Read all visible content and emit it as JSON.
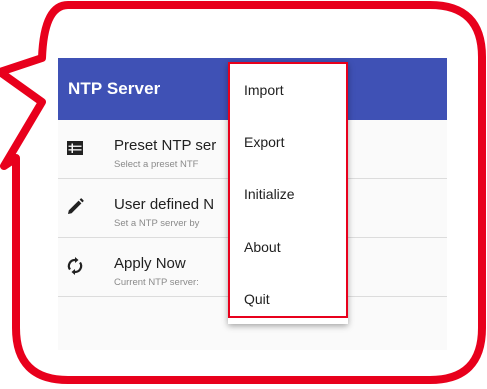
{
  "app": {
    "title": "NTP Server"
  },
  "list": [
    {
      "icon": "list-view-icon",
      "title": "Preset NTP ser",
      "subtitle": "Select a preset NTF"
    },
    {
      "icon": "pencil-icon",
      "title": "User defined N",
      "subtitle": "Set a NTP server by"
    },
    {
      "icon": "sync-icon",
      "title": "Apply Now",
      "subtitle": "Current NTP server:"
    }
  ],
  "menu": {
    "items": [
      "Import",
      "Export",
      "Initialize",
      "About",
      "Quit"
    ]
  },
  "colors": {
    "appbar": "#3f51b5",
    "callout": "#e8001c",
    "highlight": "#e8001c"
  }
}
